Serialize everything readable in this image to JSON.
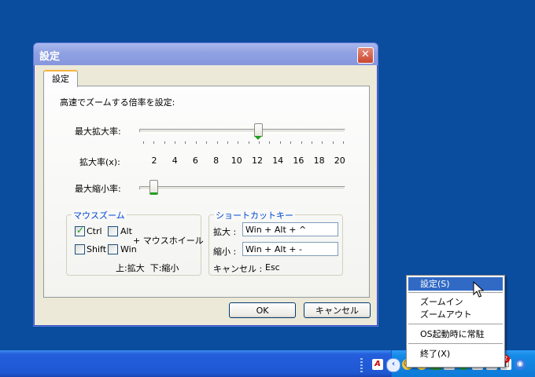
{
  "window": {
    "title": "設定",
    "close_glyph": "✕"
  },
  "tab": {
    "label": "設定"
  },
  "zoom": {
    "heading": "高速でズームする倍率を設定:",
    "max_zoom_label": "最大拡大率:",
    "scale_label": "拡大率(x):",
    "scale_values": [
      "2",
      "4",
      "6",
      "8",
      "10",
      "12",
      "14",
      "16",
      "18",
      "20"
    ],
    "min_zoom_label": "最大縮小率:",
    "max_zoom_value": 12,
    "min_zoom_value": 0
  },
  "mouse": {
    "legend": "マウスズーム",
    "ctrl": "Ctrl",
    "ctrl_checked": true,
    "alt": "Alt",
    "alt_checked": false,
    "shift": "Shift",
    "shift_checked": false,
    "win": "Win",
    "win_checked": false,
    "plus_wheel": "+ マウスホイール",
    "hint": "上:拡大  下:縮小"
  },
  "shortcut": {
    "legend": "ショートカットキー",
    "zoom_in_label": "拡大 :",
    "zoom_in_value": "Win + Alt + ^",
    "zoom_out_label": "縮小 :",
    "zoom_out_value": "Win + Alt + -",
    "cancel_label": "キャンセル :",
    "cancel_value": "Esc"
  },
  "buttons": {
    "ok": "OK",
    "cancel": "キャンセル"
  },
  "menu": {
    "settings": "設定(S)",
    "zoom_in": "ズームイン",
    "zoom_out": "ズームアウト",
    "startup": "OS起動時に常駐",
    "exit": "終了(X)"
  },
  "tray": {
    "badge": "2"
  },
  "colors": {
    "desktop": "#0a4c9e",
    "accent": "#316ac5",
    "thumb": "#21a121"
  }
}
